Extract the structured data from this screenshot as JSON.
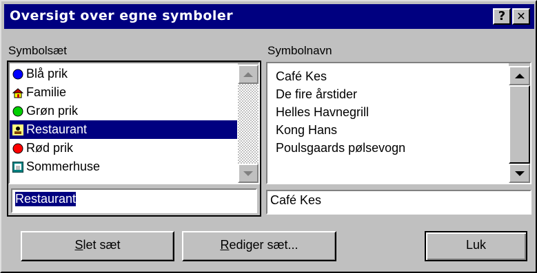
{
  "window": {
    "title": "Oversigt over egne symboler",
    "help_label": "?",
    "close_label": "✕"
  },
  "sets": {
    "label": "Symbolsæt",
    "items": [
      {
        "label": "Blå prik",
        "icon": "blue-dot-icon",
        "color": "#0000ff"
      },
      {
        "label": "Familie",
        "icon": "house-icon",
        "color": "#c00000"
      },
      {
        "label": "Grøn prik",
        "icon": "green-dot-icon",
        "color": "#00d000"
      },
      {
        "label": "Restaurant",
        "icon": "restaurant-icon",
        "color": "#000080",
        "selected": true
      },
      {
        "label": "Rød prik",
        "icon": "red-dot-icon",
        "color": "#ff0000"
      },
      {
        "label": "Sommerhuse",
        "icon": "summerhouse-icon",
        "color": "#008080"
      }
    ],
    "edit_value": "Restaurant"
  },
  "names": {
    "label": "Symbolnavn",
    "items": [
      "Café Kes",
      "De fire årstider",
      "Helles Havnegrill",
      "Kong Hans",
      "Poulsgaards pølsevogn"
    ],
    "edit_value": "Café Kes"
  },
  "buttons": {
    "delete": {
      "mnemonic": "S",
      "rest": "let sæt"
    },
    "edit": {
      "mnemonic": "R",
      "rest": "ediger sæt..."
    },
    "close": {
      "label": "Luk"
    }
  },
  "colors": {
    "titlebar": "#000080",
    "face": "#c0c0c0",
    "selection": "#000080"
  }
}
